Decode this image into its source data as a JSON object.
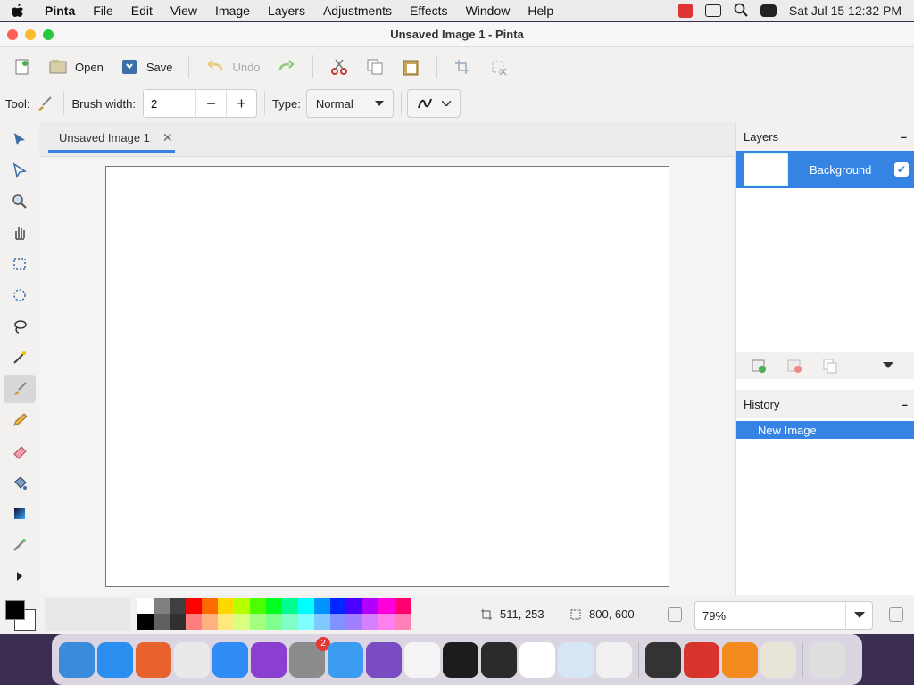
{
  "menubar": {
    "app": "Pinta",
    "items": [
      "File",
      "Edit",
      "View",
      "Image",
      "Layers",
      "Adjustments",
      "Effects",
      "Window",
      "Help"
    ],
    "datetime": "Sat Jul 15  12:32 PM"
  },
  "window": {
    "title": "Unsaved Image 1 - Pinta"
  },
  "toolbar": {
    "open": "Open",
    "save": "Save",
    "undo": "Undo"
  },
  "options": {
    "tool_label": "Tool:",
    "brush_width_label": "Brush width:",
    "brush_width_value": "2",
    "type_label": "Type:",
    "type_value": "Normal"
  },
  "document": {
    "tab_title": "Unsaved Image 1"
  },
  "layers": {
    "title": "Layers",
    "items": [
      {
        "name": "Background",
        "visible": true
      }
    ]
  },
  "history": {
    "title": "History",
    "items": [
      "New Image"
    ]
  },
  "status": {
    "cursor_pos": "511, 253",
    "image_size": "800, 600",
    "zoom": "79%"
  },
  "palette": {
    "top": [
      "#ffffff",
      "#808080",
      "#404040",
      "#ff0000",
      "#ff6a00",
      "#ffd800",
      "#b6ff00",
      "#4cff00",
      "#00ff21",
      "#00ff90",
      "#00ffff",
      "#0094ff",
      "#0026ff",
      "#4800ff",
      "#b200ff",
      "#ff00dc",
      "#ff006e"
    ],
    "bottom": [
      "#000000",
      "#606060",
      "#303030",
      "#ff7f7f",
      "#ffb27f",
      "#ffe97f",
      "#daff7f",
      "#a5ff7f",
      "#7fff8e",
      "#7fffc5",
      "#7fffff",
      "#7fc9ff",
      "#7f92ff",
      "#a17fff",
      "#d67fff",
      "#ff7fed",
      "#ff7fb6"
    ]
  },
  "colors": {
    "accent": "#3584e4"
  },
  "dock": {
    "apps": [
      "finder",
      "safari",
      "firefox",
      "chrome",
      "app-store",
      "podcasts",
      "system-settings",
      "weather",
      "visual-studio",
      "textedit",
      "terminal",
      "console",
      "vscode",
      "preview",
      "launchpad",
      "calculator",
      "parallels",
      "books",
      "pinta",
      "trash"
    ],
    "settings_badge": "2"
  }
}
